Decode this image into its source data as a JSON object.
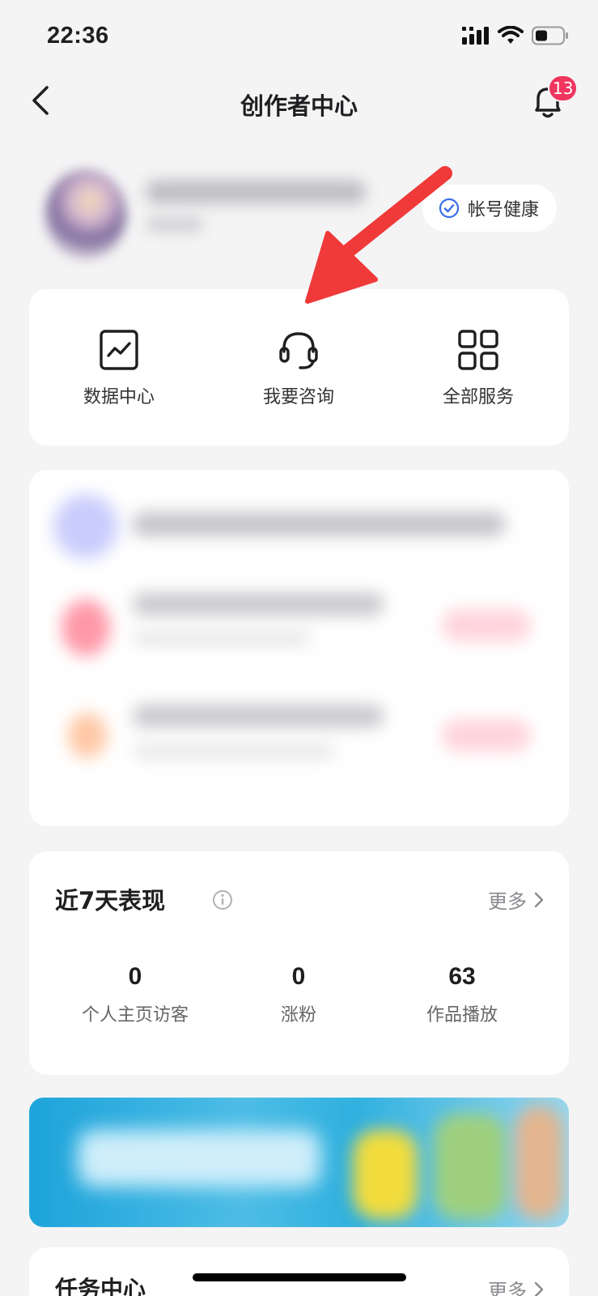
{
  "status_bar": {
    "time": "22:36"
  },
  "nav": {
    "title": "创作者中心",
    "notification_count": "13"
  },
  "profile": {
    "health_label": "帐号健康"
  },
  "quick_actions": [
    {
      "label": "数据中心",
      "icon": "chart-icon"
    },
    {
      "label": "我要咨询",
      "icon": "headset-icon"
    },
    {
      "label": "全部服务",
      "icon": "grid-icon"
    }
  ],
  "stats": {
    "title": "近7天表现",
    "more_label": "更多",
    "items": [
      {
        "value": "0",
        "label": "个人主页访客"
      },
      {
        "value": "0",
        "label": "涨粉"
      },
      {
        "value": "63",
        "label": "作品播放"
      }
    ]
  },
  "task_center": {
    "title": "任务中心",
    "more_label": "更多"
  },
  "annotation": {
    "arrow_color": "#f03a3a"
  },
  "colors": {
    "badge": "#f0355f",
    "health_check": "#3a6ee8",
    "background": "#f4f4f5"
  }
}
